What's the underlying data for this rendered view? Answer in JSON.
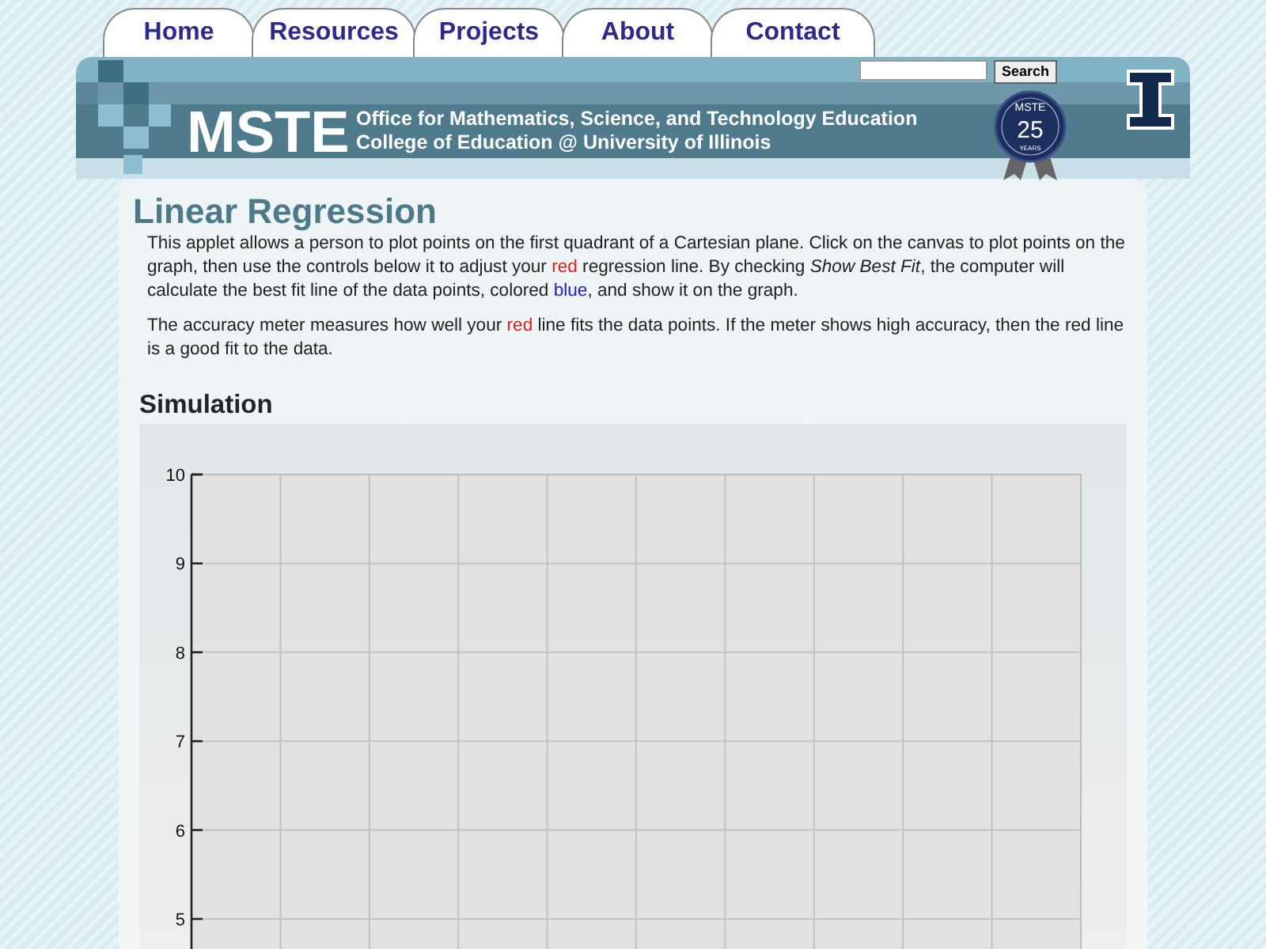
{
  "tabs": [
    {
      "label": "Home"
    },
    {
      "label": "Resources"
    },
    {
      "label": "Projects"
    },
    {
      "label": "About"
    },
    {
      "label": "Contact"
    }
  ],
  "search": {
    "button": "Search"
  },
  "header": {
    "logo": "MSTE",
    "lines": [
      "Office for Mathematics, Science, and Technology Education",
      "College of Education @ University of Illinois"
    ],
    "badge": {
      "top": "MSTE",
      "number": "25",
      "bottom": "YEARS"
    }
  },
  "title": "Linear Regression",
  "paragraphs": [
    [
      {
        "kind": "plain",
        "text": "This applet allows a person to plot points on the first quadrant of a Cartesian plane. Click on the canvas to plot points on the graph, then use the controls below it to adjust your "
      },
      {
        "kind": "red",
        "text": "red"
      },
      {
        "kind": "plain",
        "text": " regression line. By checking "
      },
      {
        "kind": "italic",
        "text": "Show Best Fit"
      },
      {
        "kind": "plain",
        "text": ", the computer will calculate the best fit line of the data points, colored "
      },
      {
        "kind": "blue",
        "text": "blue"
      },
      {
        "kind": "plain",
        "text": ", and show it on the graph."
      }
    ],
    [
      {
        "kind": "plain",
        "text": "The accuracy meter measures how well your "
      },
      {
        "kind": "red",
        "text": "red"
      },
      {
        "kind": "plain",
        "text": " line fits the data points. If the meter shows high accuracy, then the red line is a good fit to the data."
      }
    ]
  ],
  "section": "Simulation",
  "graph": {
    "y_tick_labels": [
      "10",
      "9",
      "8",
      "7",
      "6",
      "5"
    ]
  }
}
